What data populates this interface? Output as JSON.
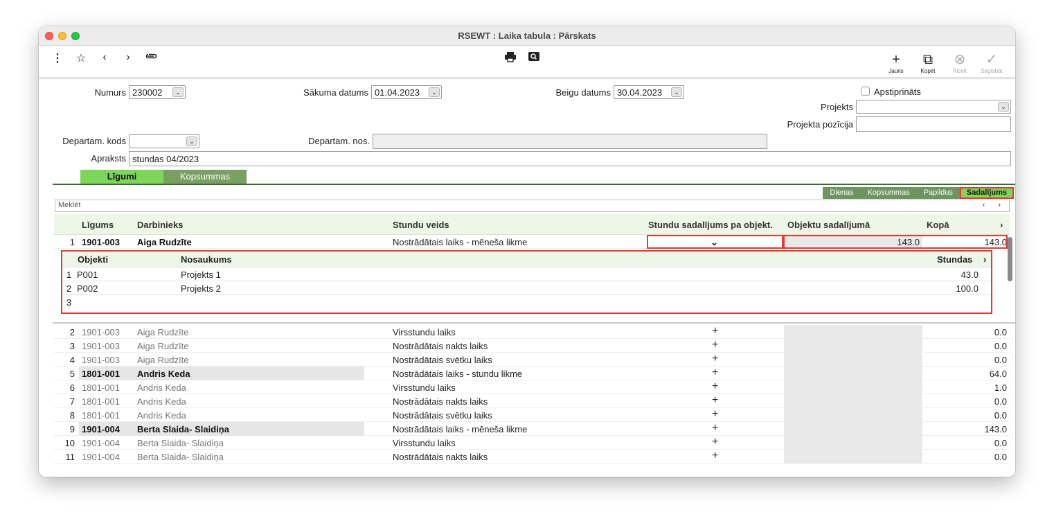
{
  "window": {
    "title": "RSEWT : Laika tabula : Pārskats"
  },
  "toolbar": {
    "right": [
      {
        "label": "Jauns",
        "icon": "plus-icon",
        "symbol": "+"
      },
      {
        "label": "Kopēt",
        "icon": "copy-icon",
        "symbol": "⧉"
      },
      {
        "label": "Atcelt",
        "icon": "cancel-icon",
        "symbol": "⊗"
      },
      {
        "label": "Saglabāt",
        "icon": "checkmark-icon",
        "symbol": "✓"
      }
    ]
  },
  "form": {
    "numurs_label": "Numurs",
    "numurs_value": "230002",
    "sakuma_label": "Sākuma datums",
    "sakuma_value": "01.04.2023",
    "beigu_label": "Beigu datums",
    "beigu_value": "30.04.2023",
    "apstiprinats_label": "Apstiprināts",
    "projekts_label": "Projekts",
    "projekts_value": "",
    "pozicija_label": "Projekta pozīcija",
    "pozicija_value": "",
    "dep_kods_label": "Departam. kods",
    "dep_kods_value": "",
    "dep_nos_label": "Departam. nos.",
    "dep_nos_value": "",
    "apraksts_label": "Apraksts",
    "apraksts_value": "stundas 04/2023"
  },
  "tabs": {
    "ligumi": "Līgumi",
    "kopsummas": "Kopsummas"
  },
  "subtabs": {
    "dienas": "Dienas",
    "kopsummas": "Kopsummas",
    "papildus": "Papildus",
    "sadalijums": "Sadalījums"
  },
  "search": {
    "placeholder": "Meklēt",
    "nav": "‹ ›"
  },
  "grid": {
    "headers": {
      "ligums": "Līgums",
      "darbinieks": "Darbinieks",
      "stundu_veids": "Stundu veids",
      "sadalijums": "Stundu sadalījums pa objekt.",
      "objektu": "Objektu sadalījumā",
      "kopa": "Kopā",
      "more": "›"
    },
    "first_row": {
      "num": "1",
      "ligums": "1901-003",
      "darbinieks": "Aiga Rudzīte",
      "veids": "Nostrādātais laiks - mēneša likme",
      "dropdown": "⌄",
      "objektu": "143.0",
      "kopa": "143.0"
    },
    "nested": {
      "headers": {
        "objekti": "Objekti",
        "nosaukums": "Nosaukums",
        "stundas": "Stundas",
        "more": "›"
      },
      "rows": [
        {
          "num": "1",
          "obj": "P001",
          "nos": "Projekts 1",
          "st": "43.0"
        },
        {
          "num": "2",
          "obj": "P002",
          "nos": "Projekts 2",
          "st": "100.0"
        },
        {
          "num": "3",
          "obj": "",
          "nos": "",
          "st": ""
        }
      ]
    },
    "rows": [
      {
        "num": "2",
        "ligums": "1901-003",
        "darbinieks": "Aiga Rudzīte",
        "veids": "Virsstundu laiks",
        "plus": "+",
        "kopa": "0.0",
        "bold": false
      },
      {
        "num": "3",
        "ligums": "1901-003",
        "darbinieks": "Aiga Rudzīte",
        "veids": "Nostrādātais nakts laiks",
        "plus": "+",
        "kopa": "0.0",
        "bold": false
      },
      {
        "num": "4",
        "ligums": "1901-003",
        "darbinieks": "Aiga Rudzīte",
        "veids": "Nostrādātais svētku laiks",
        "plus": "+",
        "kopa": "0.0",
        "bold": false
      },
      {
        "num": "5",
        "ligums": "1801-001",
        "darbinieks": "Andris Keda",
        "veids": "Nostrādātais laiks - stundu likme",
        "plus": "+",
        "kopa": "64.0",
        "bold": true
      },
      {
        "num": "6",
        "ligums": "1801-001",
        "darbinieks": "Andris Keda",
        "veids": "Virsstundu laiks",
        "plus": "+",
        "kopa": "1.0",
        "bold": false
      },
      {
        "num": "7",
        "ligums": "1801-001",
        "darbinieks": "Andris Keda",
        "veids": "Nostrādātais nakts laiks",
        "plus": "+",
        "kopa": "0.0",
        "bold": false
      },
      {
        "num": "8",
        "ligums": "1801-001",
        "darbinieks": "Andris Keda",
        "veids": "Nostrādātais svētku laiks",
        "plus": "+",
        "kopa": "0.0",
        "bold": false
      },
      {
        "num": "9",
        "ligums": "1901-004",
        "darbinieks": "Berta Slaida- Slaidiņa",
        "veids": "Nostrādātais laiks - mēneša likme",
        "plus": "+",
        "kopa": "143.0",
        "bold": true
      },
      {
        "num": "10",
        "ligums": "1901-004",
        "darbinieks": "Berta Slaida- Slaidiņa",
        "veids": "Virsstundu laiks",
        "plus": "+",
        "kopa": "0.0",
        "bold": false
      },
      {
        "num": "11",
        "ligums": "1901-004",
        "darbinieks": "Berta Slaida- Slaidiņa",
        "veids": "Nostrādātais nakts laiks",
        "plus": "+",
        "kopa": "0.0",
        "bold": false
      }
    ]
  },
  "colors": {
    "active_tab": "#7dd65a",
    "inactive_tab": "#7a9f63",
    "highlight": "#e53935"
  }
}
